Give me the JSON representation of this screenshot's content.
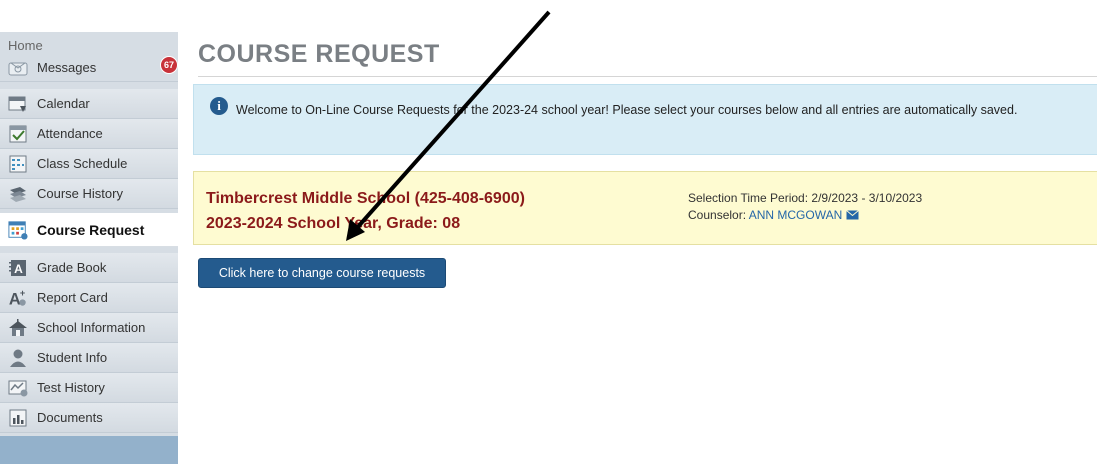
{
  "sidebar": {
    "home_label": "Home",
    "items": [
      {
        "label": "Messages",
        "icon": "envelope-icon"
      },
      {
        "label": "Calendar",
        "icon": "calendar-icon"
      },
      {
        "label": "Attendance",
        "icon": "attendance-check-icon"
      },
      {
        "label": "Class Schedule",
        "icon": "schedule-grid-icon"
      },
      {
        "label": "Course History",
        "icon": "course-history-icon"
      },
      {
        "label": "Course Request",
        "icon": "course-request-icon",
        "active": true
      },
      {
        "label": "Grade Book",
        "icon": "gradebook-icon"
      },
      {
        "label": "Report Card",
        "icon": "report-card-icon"
      },
      {
        "label": "School Information",
        "icon": "school-icon"
      },
      {
        "label": "Student Info",
        "icon": "student-icon"
      },
      {
        "label": "Test History",
        "icon": "test-history-icon"
      },
      {
        "label": "Documents",
        "icon": "documents-icon"
      }
    ],
    "messages_badge": "67"
  },
  "main": {
    "title": "COURSE REQUEST",
    "info_message": "Welcome to On-Line Course Requests for the 2023-24 school year! Please select your courses below and all entries are automatically saved.",
    "school_name": "Timbercrest Middle School (425-408-6900)",
    "school_year_grade": "2023-2024 School Year, Grade: 08",
    "selection_period": "Selection Time Period: 2/9/2023 - 3/10/2023",
    "counselor_label": "Counselor:",
    "counselor_name": "ANN MCGOWAN",
    "change_button": "Click here to change course requests"
  },
  "colors": {
    "accent_blue": "#245b8e",
    "info_bg": "#d9edf6",
    "school_bg": "#fefbd1",
    "school_text": "#8b1a1a",
    "badge_red": "#c8323a"
  }
}
